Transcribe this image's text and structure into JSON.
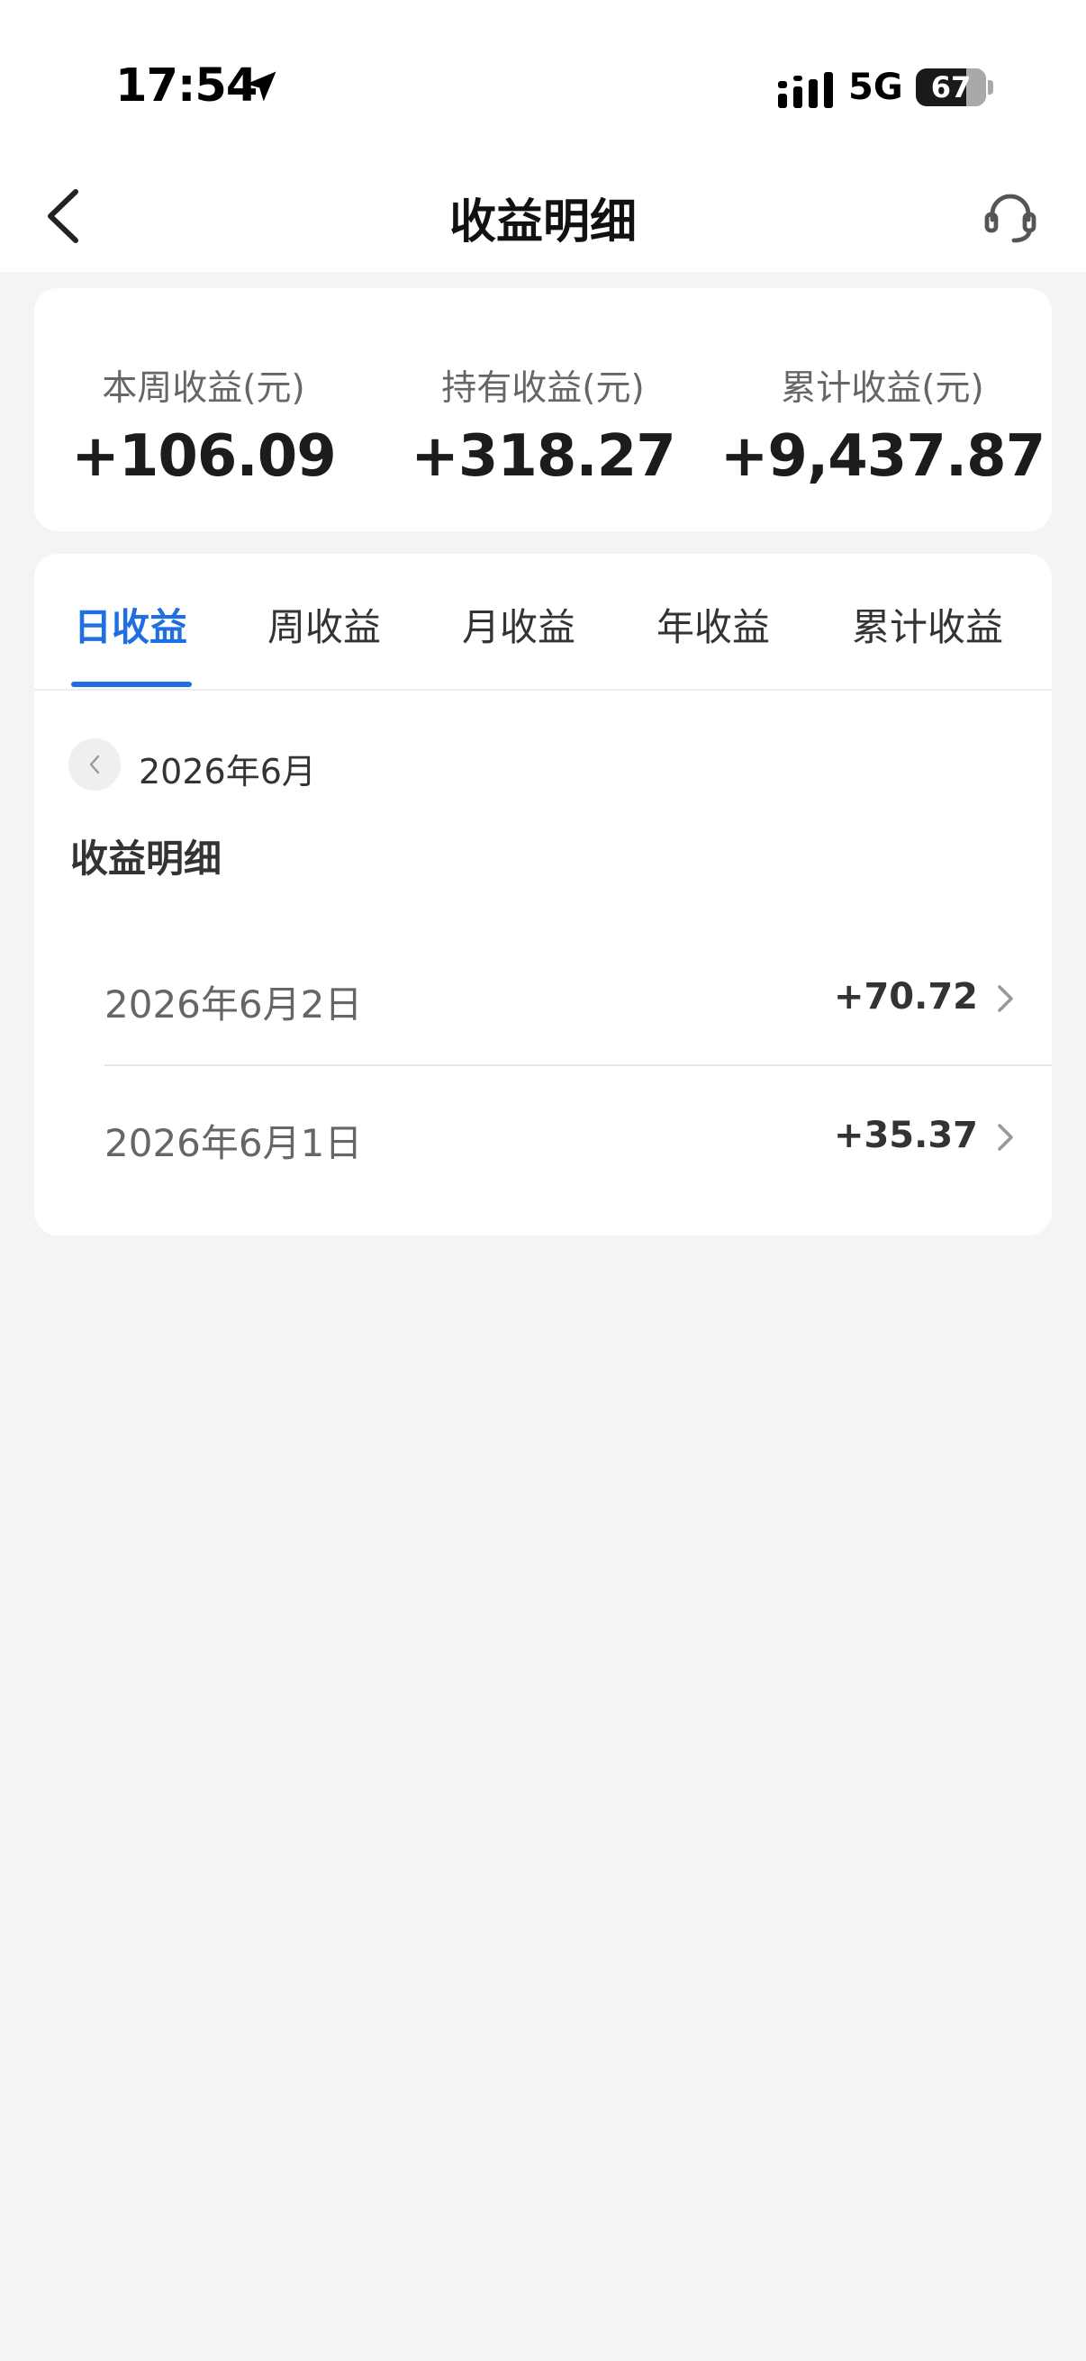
{
  "status_bar": {
    "time": "17:54",
    "network": "5G",
    "battery": 67,
    "icons": [
      "location-arrow-icon",
      "signal-icon",
      "battery-icon"
    ]
  },
  "nav": {
    "title": "收益明细",
    "icons": [
      "chevron-left-icon",
      "headset-icon"
    ]
  },
  "summary": {
    "items": [
      {
        "label": "本周收益(元)",
        "value": "+106.09"
      },
      {
        "label": "持有收益(元)",
        "value": "+318.27"
      },
      {
        "label": "累计收益(元)",
        "value": "+9,437.87"
      }
    ]
  },
  "tabs": {
    "active_index": 0,
    "items": [
      {
        "label": "日收益"
      },
      {
        "label": "周收益"
      },
      {
        "label": "月收益"
      },
      {
        "label": "年收益"
      },
      {
        "label": "累计收益"
      }
    ]
  },
  "period": {
    "month": "2026年6月"
  },
  "details": {
    "title": "收益明细",
    "rows": [
      {
        "date": "2026年6月2日",
        "amount": "+70.72"
      },
      {
        "date": "2026年6月1日",
        "amount": "+35.37"
      }
    ]
  },
  "colors": {
    "accent": "#1f6fe0",
    "background": "#f4f4f4",
    "card": "#ffffff",
    "text_primary": "#1c1c1c",
    "text_secondary": "#666666"
  }
}
